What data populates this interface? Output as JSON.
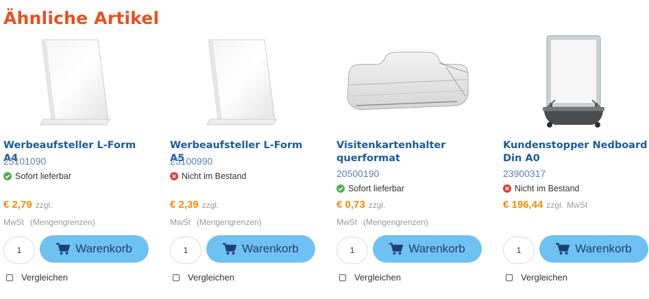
{
  "section": {
    "title": "Ähnliche Artikel"
  },
  "colors": {
    "title": "#e8501e",
    "product_name": "#1a5a9c",
    "sku": "#5b7db3",
    "price": "#f28c00",
    "cart_button": "#6ec1f2",
    "in_stock": "#4caf50",
    "out_of_stock": "#e53935"
  },
  "products": [
    {
      "name": "Werbeaufsteller L-Form A4",
      "sku": "25101090",
      "stock": "Sofort lieferbar",
      "stock_icon": "check-circle-icon",
      "price": "€ 2,79",
      "vat_prefix": "zzgl.",
      "vat": "MwSt",
      "quantity_note": "(Mengengrenzen)",
      "quantity": "1",
      "cart_label": "Warenkorb",
      "compare_label": "Vergleichen"
    },
    {
      "name": "Werbeaufsteller L-Form A5",
      "sku": "25100990",
      "stock": "Nicht im Bestand",
      "stock_icon": "x-circle-icon",
      "price": "€ 2,39",
      "vat_prefix": "zzgl.",
      "vat": "MwSt",
      "quantity_note": "(Mengengrenzen)",
      "quantity": "1",
      "cart_label": "Warenkorb",
      "compare_label": "Vergleichen"
    },
    {
      "name_line1": "Visitenkartenhalter",
      "name_line2": "querformat",
      "sku": "20500190",
      "stock": "Sofort lieferbar",
      "stock_icon": "check-circle-icon",
      "price": "€ 0,73",
      "vat_prefix": "zzgl.",
      "vat": "MwSt",
      "quantity_note": "(Mengengrenzen)",
      "quantity": "1",
      "cart_label": "Warenkorb",
      "compare_label": "Vergleichen"
    },
    {
      "name_line1": "Kundenstopper Nedboard",
      "name_line2": "Din A0",
      "sku": "23900317",
      "stock": "Nicht im Bestand",
      "stock_icon": "x-circle-icon",
      "price": "€ 196,44",
      "vat_prefix": "zzgl.",
      "vat": "MwSt",
      "quantity": "1",
      "cart_label": "Warenkorb",
      "compare_label": "Vergleichen"
    }
  ]
}
